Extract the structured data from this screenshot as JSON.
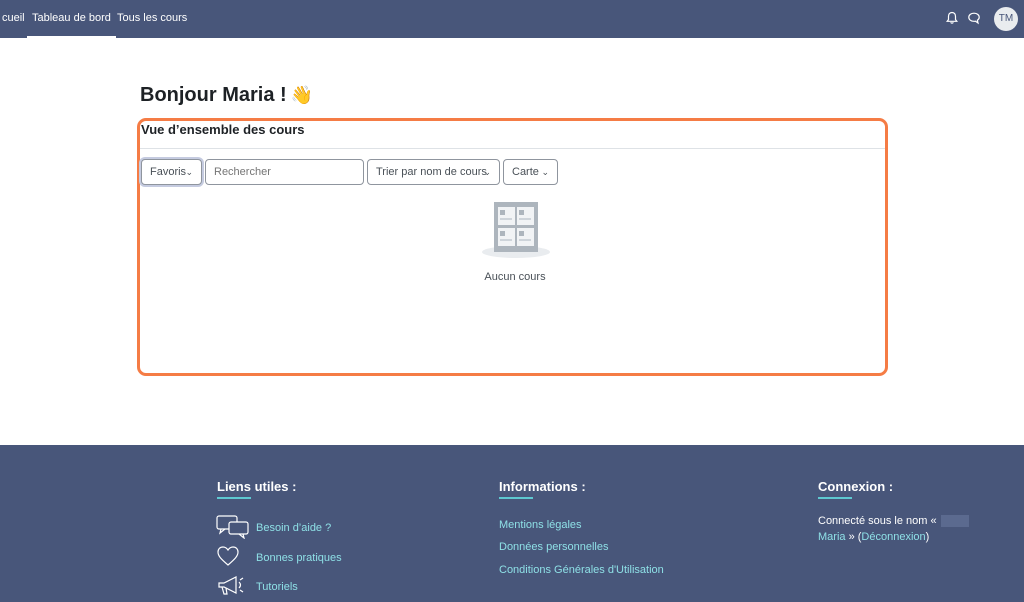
{
  "navbar": {
    "home_label": "cueil",
    "dashboard_label": "Tableau de bord",
    "courses_label": "Tous les cours",
    "avatar_initials": "TM",
    "bell_icon": "bell-icon",
    "messages_icon": "speech-bubble-icon"
  },
  "main": {
    "greeting": "Bonjour Maria !",
    "greeting_emoji": "👋",
    "overview": {
      "title": "Vue d’ensemble des cours",
      "filter_label": "Favoris",
      "search_placeholder": "Rechercher",
      "sort_label": "Trier par nom de cours",
      "view_label": "Carte",
      "empty_text": "Aucun cours",
      "highlight_color": "#f57c45"
    }
  },
  "footer": {
    "useful_links": {
      "heading": "Liens utiles :",
      "items": [
        "Besoin d’aide ?",
        "Bonnes pratiques",
        "Tutoriels"
      ],
      "icons": [
        "chat-bubbles-icon",
        "heart-icon",
        "megaphone-icon"
      ]
    },
    "information": {
      "heading": "Informations :",
      "items": [
        "Mentions légales",
        "Données personnelles",
        "Conditions Générales d'Utilisation"
      ]
    },
    "connection": {
      "heading": "Connexion :",
      "line1": "Connecté sous le nom «",
      "user_name": "Maria",
      "suffix": " » (",
      "logout_label": "Déconnexion",
      "close_paren": ")"
    }
  },
  "colors": {
    "navbar_bg": "#48567a",
    "footer_bg": "#48567a",
    "link_accent": "#8ee0e6",
    "underline_accent": "#5ec8d0"
  }
}
